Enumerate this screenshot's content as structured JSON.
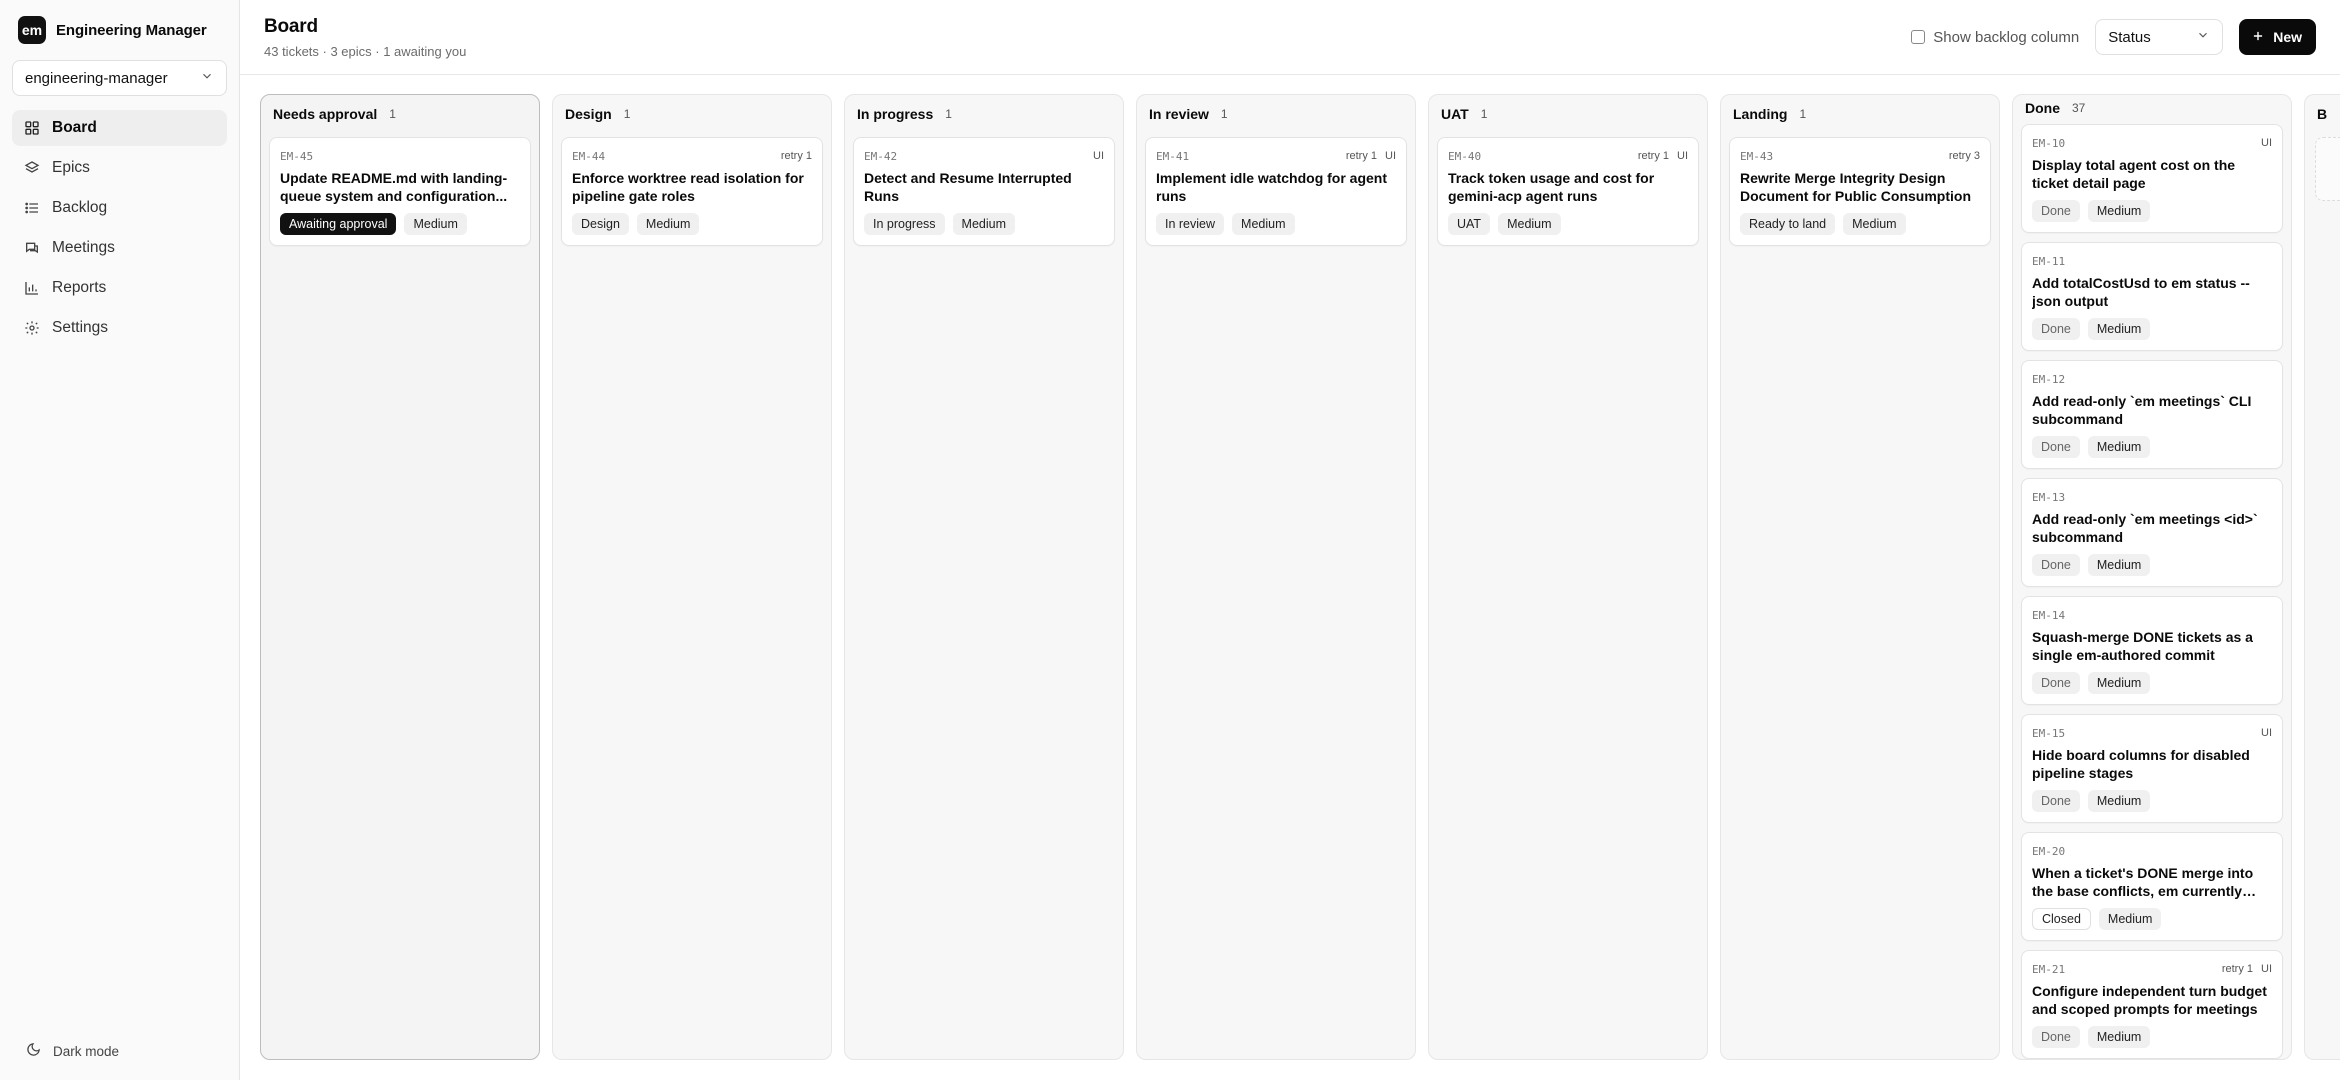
{
  "sidebar": {
    "logo_text": "em",
    "app_name": "Engineering Manager",
    "project": "engineering-manager",
    "nav": [
      {
        "label": "Board",
        "icon": "grid-icon",
        "active": true
      },
      {
        "label": "Epics",
        "icon": "layers-icon"
      },
      {
        "label": "Backlog",
        "icon": "list-icon"
      },
      {
        "label": "Meetings",
        "icon": "chat-icon"
      },
      {
        "label": "Reports",
        "icon": "bar-chart-icon"
      },
      {
        "label": "Settings",
        "icon": "gear-icon"
      }
    ],
    "dark_mode_label": "Dark mode"
  },
  "header": {
    "title": "Board",
    "subtitle": "43 tickets · 3 epics · 1 awaiting you",
    "show_backlog_label": "Show backlog column",
    "status_select": "Status",
    "new_button": "New"
  },
  "columns": [
    {
      "name": "Needs approval",
      "count": "1",
      "cards": [
        {
          "id": "EM-45",
          "meta": "",
          "tag": "",
          "title": "Update README.md with landing-queue system and configuration...",
          "status": "Awaiting approval",
          "status_style": "dark",
          "priority": "Medium"
        }
      ]
    },
    {
      "name": "Design",
      "count": "1",
      "cards": [
        {
          "id": "EM-44",
          "meta": "retry 1",
          "tag": "",
          "title": "Enforce worktree read isolation for pipeline gate roles",
          "status": "Design",
          "status_style": "",
          "priority": "Medium"
        }
      ]
    },
    {
      "name": "In progress",
      "count": "1",
      "cards": [
        {
          "id": "EM-42",
          "meta": "",
          "tag": "UI",
          "title": "Detect and Resume Interrupted Runs",
          "status": "In progress",
          "status_style": "",
          "priority": "Medium"
        }
      ]
    },
    {
      "name": "In review",
      "count": "1",
      "cards": [
        {
          "id": "EM-41",
          "meta": "retry 1",
          "tag": "UI",
          "title": "Implement idle watchdog for agent runs",
          "status": "In review",
          "status_style": "",
          "priority": "Medium"
        }
      ]
    },
    {
      "name": "UAT",
      "count": "1",
      "cards": [
        {
          "id": "EM-40",
          "meta": "retry 1",
          "tag": "UI",
          "title": "Track token usage and cost for gemini-acp agent runs",
          "status": "UAT",
          "status_style": "",
          "priority": "Medium"
        }
      ]
    },
    {
      "name": "Landing",
      "count": "1",
      "cards": [
        {
          "id": "EM-43",
          "meta": "retry 3",
          "tag": "",
          "title": "Rewrite Merge Integrity Design Document for Public Consumption",
          "status": "Ready to land",
          "status_style": "",
          "priority": "Medium"
        }
      ]
    },
    {
      "name": "Done",
      "count": "37",
      "cards": [
        {
          "id": "EM-10",
          "meta": "",
          "tag": "UI",
          "title": "Display total agent cost on the ticket detail page",
          "status": "Done",
          "status_style": "muted",
          "priority": "Medium"
        },
        {
          "id": "EM-11",
          "meta": "",
          "tag": "",
          "title": "Add totalCostUsd to em status --json output",
          "status": "Done",
          "status_style": "muted",
          "priority": "Medium"
        },
        {
          "id": "EM-12",
          "meta": "",
          "tag": "",
          "title": "Add read-only `em meetings` CLI subcommand",
          "status": "Done",
          "status_style": "muted",
          "priority": "Medium"
        },
        {
          "id": "EM-13",
          "meta": "",
          "tag": "",
          "title": "Add read-only `em meetings <id>` subcommand",
          "status": "Done",
          "status_style": "muted",
          "priority": "Medium"
        },
        {
          "id": "EM-14",
          "meta": "",
          "tag": "",
          "title": "Squash-merge DONE tickets as a single em-authored commit",
          "status": "Done",
          "status_style": "muted",
          "priority": "Medium"
        },
        {
          "id": "EM-15",
          "meta": "",
          "tag": "UI",
          "title": "Hide board columns for disabled pipeline stages",
          "status": "Done",
          "status_style": "muted",
          "priority": "Medium"
        },
        {
          "id": "EM-20",
          "meta": "",
          "tag": "",
          "title": "When a ticket's DONE merge into the base conflicts, em currently logs a...",
          "status": "Closed",
          "status_style": "outline",
          "priority": "Medium"
        },
        {
          "id": "EM-21",
          "meta": "retry 1",
          "tag": "UI",
          "title": "Configure independent turn budget and scoped prompts for meetings",
          "status": "Done",
          "status_style": "muted",
          "priority": "Medium"
        }
      ]
    }
  ],
  "partial_column": {
    "name": "B"
  }
}
